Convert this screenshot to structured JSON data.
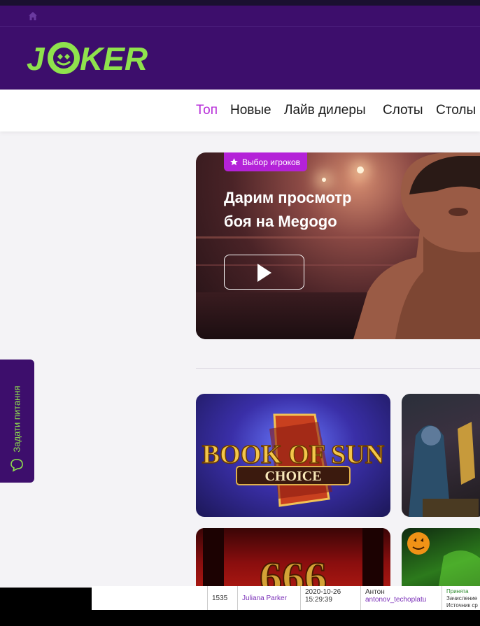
{
  "header": {
    "logo_text": "JOKER",
    "logo_color": "#8fe24d",
    "bg_color": "#3d0e6c"
  },
  "topbar": {
    "home_icon": "home-icon"
  },
  "nav": {
    "active_color": "#b62bd8",
    "items": [
      {
        "label": "Топ"
      },
      {
        "label": "Новые"
      },
      {
        "label": "Лайв дилеры"
      },
      {
        "label": "Слоты"
      },
      {
        "label": "Столы"
      }
    ]
  },
  "banner": {
    "badge_icon": "star-icon",
    "badge_label": "Выбор игроков",
    "title_line1": "Дарим просмотр",
    "title_line2": "боя на Megogo",
    "play_icon": "play-icon"
  },
  "games": [
    {
      "name": "BOOK OF SUN",
      "subtitle": "CHOICE"
    },
    {
      "name": ""
    },
    {
      "name": "666"
    },
    {
      "name": ""
    }
  ],
  "side_tab": {
    "label": "Задати питання",
    "icon": "chat-icon"
  },
  "bottom_table": {
    "id": "1535",
    "user": "Juliana Parker",
    "date": "2020-10-26",
    "time": "15:29:39",
    "name": "Антон",
    "login": "antonov_techoplatu",
    "status": "Принята",
    "note1": "Зачисление",
    "note2": "Источник ср"
  }
}
